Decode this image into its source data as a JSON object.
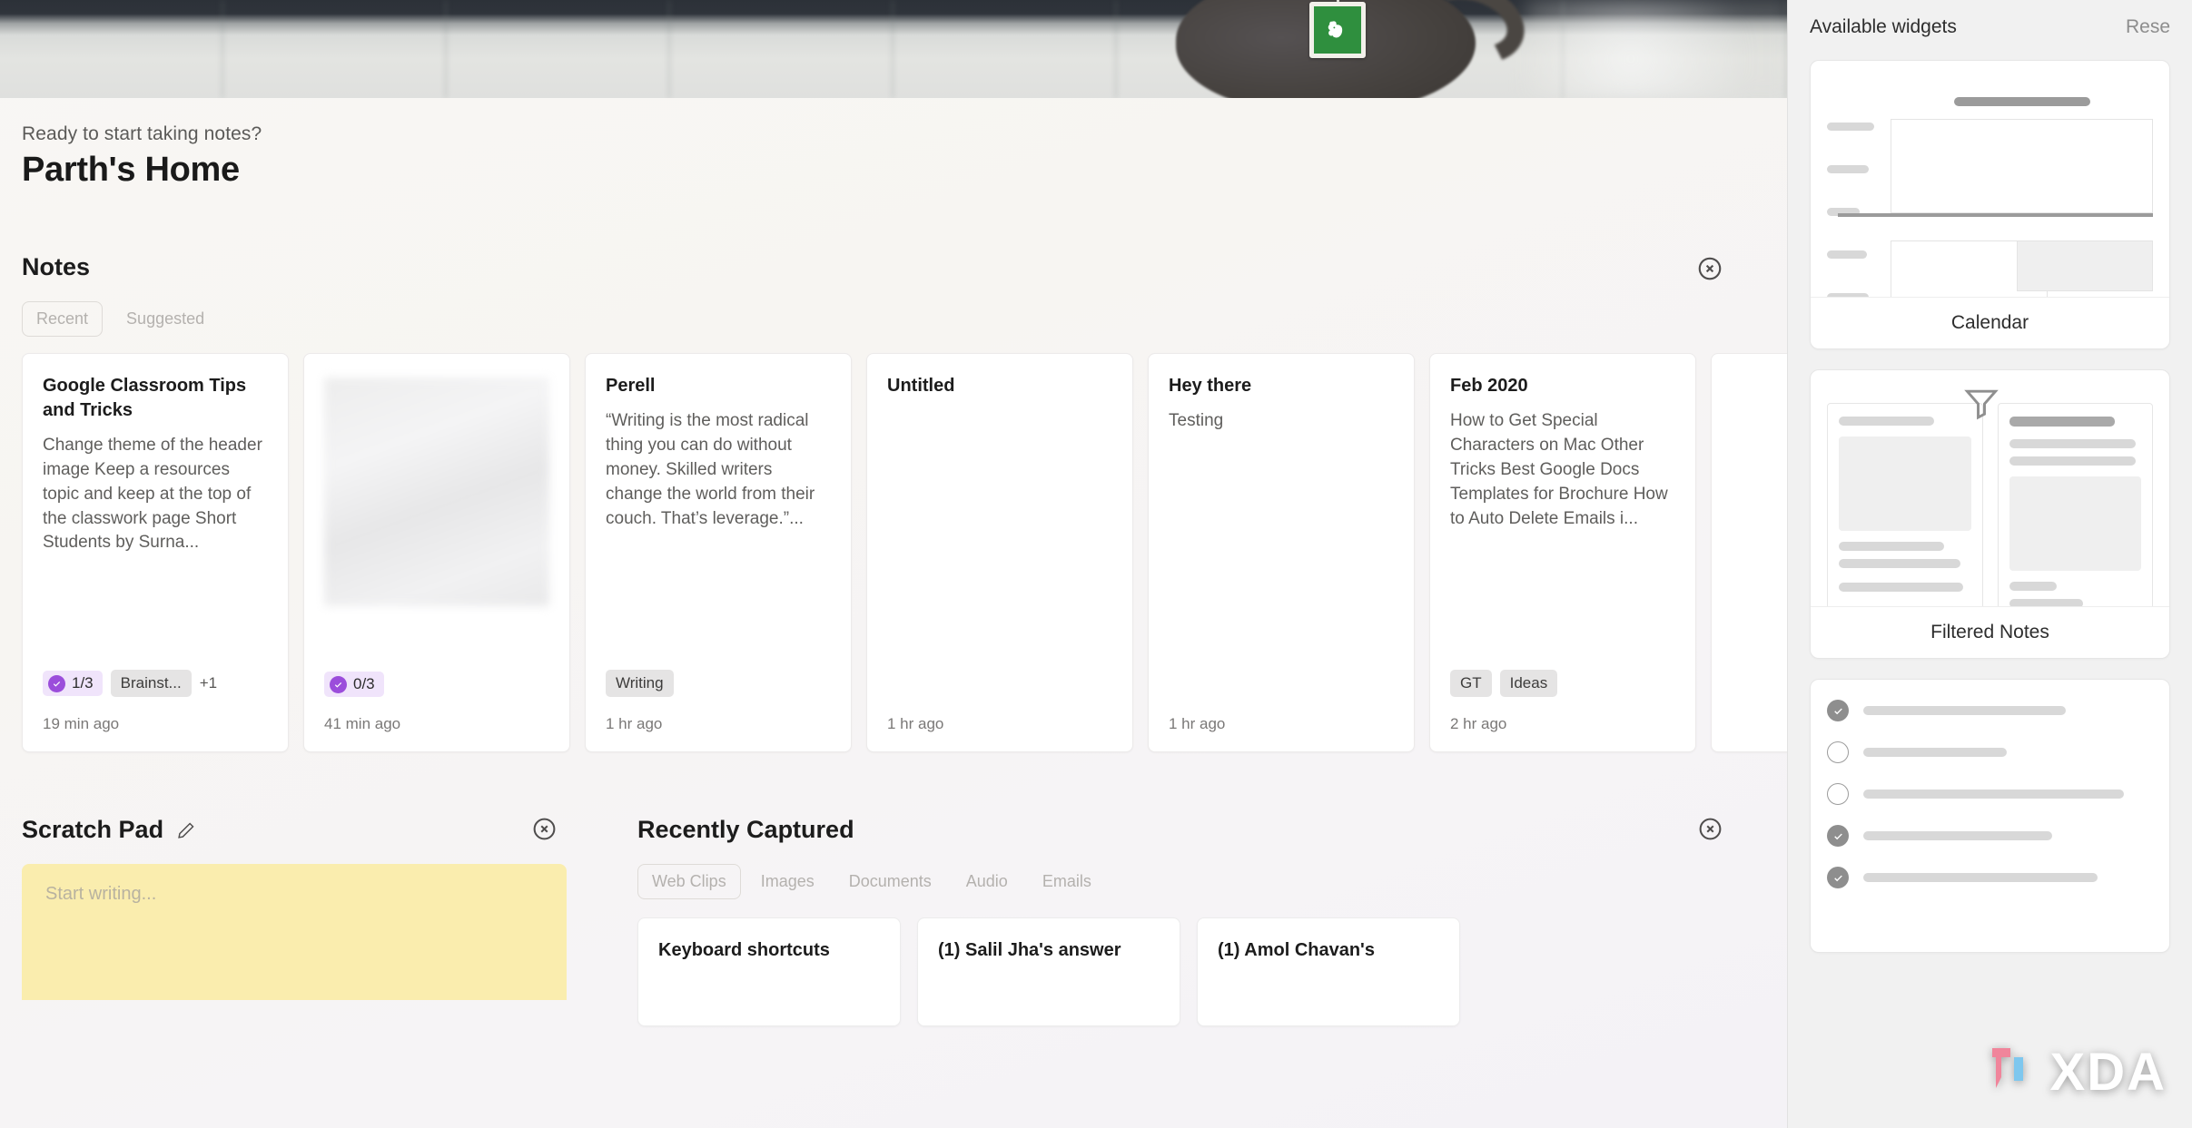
{
  "banner": {
    "logo_icon": "evernote-elephant-icon"
  },
  "greeting": {
    "subtitle": "Ready to start taking notes?",
    "title": "Parth's Home"
  },
  "notes_section": {
    "title": "Notes",
    "close_icon": "close-circle-icon",
    "tabs": [
      {
        "label": "Recent",
        "active": true
      },
      {
        "label": "Suggested",
        "active": false
      }
    ],
    "cards": [
      {
        "title": "Google Classroom Tips and Tricks",
        "snippet": "Change theme of the header image Keep a resources topic and keep at the top of the classwork page Short Students by Surna...",
        "task_badge": "1/3",
        "tags": [
          "Brainst..."
        ],
        "extra_tags": "+1",
        "time": "19 min ago",
        "has_thumb": false
      },
      {
        "title": "",
        "snippet": "",
        "task_badge": "0/3",
        "tags": [],
        "extra_tags": "",
        "time": "41 min ago",
        "has_thumb": true
      },
      {
        "title": "Perell",
        "snippet": "“Writing is the most radical thing you can do without money. Skilled writers change the world from their couch. That’s leverage.”...",
        "task_badge": "",
        "tags": [
          "Writing"
        ],
        "extra_tags": "",
        "time": "1 hr ago",
        "has_thumb": false
      },
      {
        "title": "Untitled",
        "snippet": "",
        "task_badge": "",
        "tags": [],
        "extra_tags": "",
        "time": "1 hr ago",
        "has_thumb": false
      },
      {
        "title": "Hey there",
        "snippet": "Testing",
        "task_badge": "",
        "tags": [],
        "extra_tags": "",
        "time": "1 hr ago",
        "has_thumb": false
      },
      {
        "title": "Feb 2020",
        "snippet": "How to Get Special Characters on Mac Other Tricks Best Google Docs Templates for Brochure How to Auto Delete Emails i...",
        "task_badge": "",
        "tags": [
          "GT",
          "Ideas"
        ],
        "extra_tags": "",
        "time": "2 hr ago",
        "has_thumb": false
      },
      {
        "title": "",
        "snippet": "",
        "task_badge": "",
        "tags": [],
        "extra_tags": "",
        "time": "",
        "has_thumb": false
      }
    ]
  },
  "scratch_pad": {
    "title": "Scratch Pad",
    "edit_icon": "pencil-icon",
    "close_icon": "close-circle-icon",
    "placeholder": "Start writing..."
  },
  "recently_captured": {
    "title": "Recently Captured",
    "close_icon": "close-circle-icon",
    "tabs": [
      {
        "label": "Web Clips",
        "active": true
      },
      {
        "label": "Images",
        "active": false
      },
      {
        "label": "Documents",
        "active": false
      },
      {
        "label": "Audio",
        "active": false
      },
      {
        "label": "Emails",
        "active": false
      }
    ],
    "cards": [
      {
        "title": "Keyboard shortcuts"
      },
      {
        "title": "(1) Salil Jha's answer"
      },
      {
        "title": "(1) Amol Chavan's"
      }
    ]
  },
  "sidebar": {
    "title": "Available widgets",
    "reset_label": "Rese",
    "widgets": [
      {
        "label": "Calendar",
        "preview": "calendar"
      },
      {
        "label": "Filtered Notes",
        "preview": "filtered-notes",
        "icon": "funnel-icon"
      },
      {
        "label": "",
        "preview": "tasks"
      }
    ]
  },
  "watermark": {
    "text": "XDA"
  },
  "colors": {
    "accent_purple": "#9b4ddb",
    "badge_bg": "#f0e4fb",
    "tag_bg": "#e5e4e4",
    "scratch_yellow": "#faedae",
    "evernote_green": "#2f8f3e"
  }
}
